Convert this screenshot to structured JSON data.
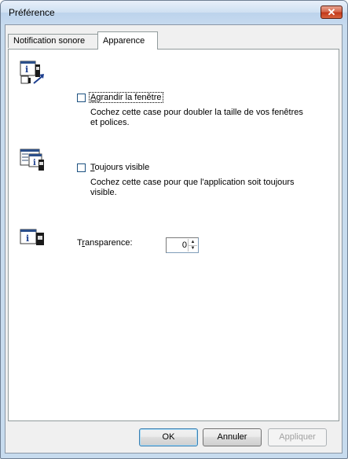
{
  "window": {
    "title": "Préférence"
  },
  "tabs": [
    {
      "label": "Notification sonore"
    },
    {
      "label": "Apparence"
    }
  ],
  "options": [
    {
      "label_first": "A",
      "label_rest": "grandir la fenêtre",
      "description": "Cochez cette case pour doubler la taille de vos fenêtres et polices.",
      "checked": false,
      "icon": "window-enlarge-icon"
    },
    {
      "label_first": "T",
      "label_rest": "oujours visible",
      "description": "Cochez cette case pour que l'application soit toujours visible.",
      "checked": false,
      "icon": "always-on-top-icon"
    }
  ],
  "transparency": {
    "label_first": "T",
    "label_u": "r",
    "label_rest": "ansparence:",
    "value": "0",
    "icon": "transparency-icon"
  },
  "buttons": {
    "ok": "OK",
    "cancel": "Annuler",
    "apply": "Appliquer"
  },
  "colors": {
    "title_bar": "#c6daef",
    "close_button": "#c2391b",
    "panel_bg": "#ffffff"
  }
}
